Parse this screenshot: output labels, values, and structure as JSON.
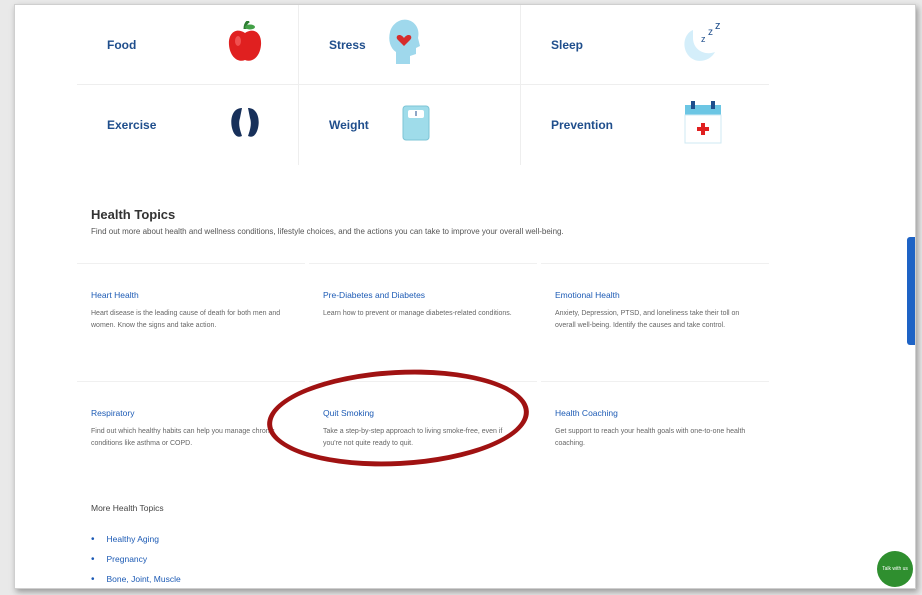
{
  "categories": [
    {
      "label": "Food",
      "icon": "apple-icon"
    },
    {
      "label": "Stress",
      "icon": "head-heart-icon"
    },
    {
      "label": "Sleep",
      "icon": "moon-zzz-icon"
    },
    {
      "label": "Exercise",
      "icon": "footprints-icon"
    },
    {
      "label": "Weight",
      "icon": "scale-icon"
    },
    {
      "label": "Prevention",
      "icon": "calendar-cross-icon"
    }
  ],
  "health_topics": {
    "title": "Health Topics",
    "description": "Find out more about health and wellness conditions, lifestyle choices, and the actions you can take to improve your overall well-being.",
    "cards": [
      {
        "title": "Heart Health",
        "desc": "Heart disease is the leading cause of death for both men and women. Know the signs and take action."
      },
      {
        "title": "Pre-Diabetes and Diabetes",
        "desc": "Learn how to prevent or manage diabetes-related conditions."
      },
      {
        "title": "Emotional Health",
        "desc": "Anxiety, Depression, PTSD, and loneliness take their toll on overall well-being. Identify the causes and take control."
      },
      {
        "title": "Respiratory",
        "desc": "Find out which healthy habits can help you manage chronic conditions like asthma or COPD."
      },
      {
        "title": "Quit Smoking",
        "desc": "Take a step-by-step approach to living smoke-free, even if you're not quite ready to quit."
      },
      {
        "title": "Health Coaching",
        "desc": "Get support to reach your health goals with one-to-one health coaching."
      }
    ]
  },
  "more_topics": {
    "title": "More Health Topics",
    "items": [
      "Healthy Aging",
      "Pregnancy",
      "Bone, Joint, Muscle"
    ]
  },
  "chat": {
    "label": "Talk with us"
  },
  "colors": {
    "link": "#1d5bb5",
    "heading": "#1f4e8c",
    "annotation": "#a01212",
    "chat": "#2f8f2f",
    "feedback": "#1e63c5"
  }
}
